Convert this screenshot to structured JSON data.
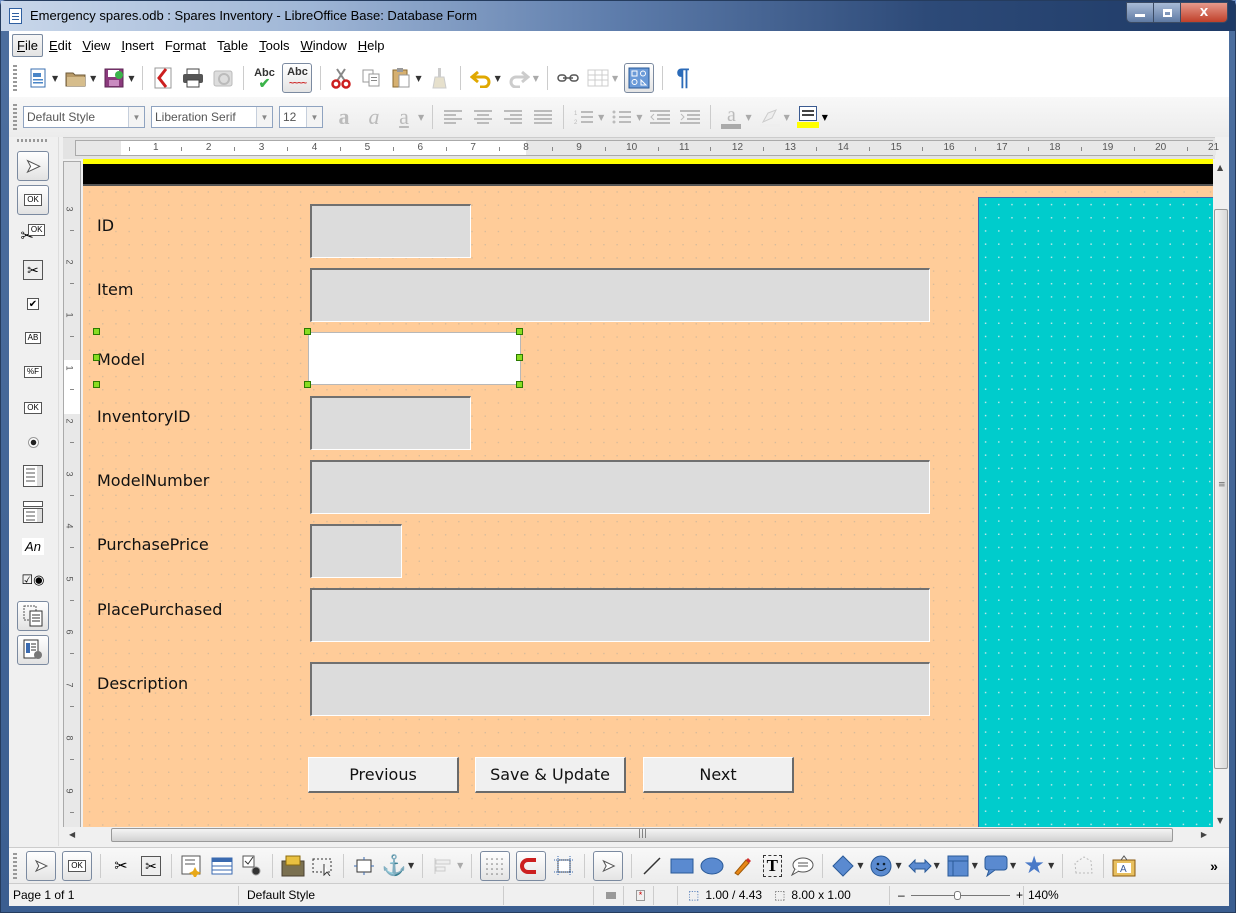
{
  "window": {
    "title": "Emergency spares.odb : Spares Inventory - LibreOffice Base: Database Form",
    "controls": {
      "minimize": "–",
      "maximize": "□",
      "close": "X"
    }
  },
  "menubar": {
    "items": [
      {
        "label": "File",
        "accel": "F",
        "rest": "ile"
      },
      {
        "label": "Edit",
        "accel": "E",
        "rest": "dit"
      },
      {
        "label": "View",
        "accel": "V",
        "rest": "iew"
      },
      {
        "label": "Insert",
        "accel": "I",
        "rest": "nsert"
      },
      {
        "label": "Format",
        "pre": "F",
        "accel": "o",
        "rest": "rmat"
      },
      {
        "label": "Table",
        "pre": "T",
        "accel": "a",
        "rest": "ble"
      },
      {
        "label": "Tools",
        "accel": "T",
        "rest": "ools"
      },
      {
        "label": "Window",
        "accel": "W",
        "rest": "indow"
      },
      {
        "label": "Help",
        "accel": "H",
        "rest": "elp"
      }
    ]
  },
  "standard_toolbar": {
    "icons": [
      "new-document-icon",
      "open-folder-icon",
      "save-icon",
      "export-pdf-icon",
      "print-icon",
      "print-preview-icon",
      "spellcheck-icon",
      "autospellcheck-icon",
      "cut-icon",
      "copy-icon",
      "paste-icon",
      "clone-formatting-icon",
      "undo-icon",
      "redo-icon",
      "hyperlink-icon",
      "table-icon",
      "draw-functions-icon",
      "formatting-marks-icon"
    ],
    "spell_label": "Abc"
  },
  "formatting_toolbar": {
    "paragraph_style": "Default Style",
    "font_name": "Liberation Serif",
    "font_size": "12",
    "highlight_color": "#ffff00"
  },
  "ruler": {
    "h_numbers": [
      "1",
      "2",
      "3",
      "4",
      "5",
      "6",
      "7",
      "8",
      "9",
      "10",
      "11",
      "12",
      "13",
      "14",
      "15",
      "16",
      "17",
      "18",
      "19",
      "20",
      "21"
    ],
    "v_numbers": [
      "3",
      "2",
      "1",
      "1",
      "2",
      "3",
      "4",
      "5",
      "6",
      "7",
      "8",
      "9"
    ]
  },
  "form_controls_toolbar": {
    "items": [
      "select-icon",
      "design-mode-icon",
      "control-properties-icon",
      "form-properties-icon",
      "checkbox-icon",
      "text-box-icon",
      "formatted-field-icon",
      "push-button-icon",
      "option-button-icon",
      "list-box-icon",
      "combo-box-icon",
      "label-field-icon",
      "more-controls-icon",
      "form-design-icon",
      "wizards-icon"
    ],
    "label_an": "An",
    "label_ok": "OK",
    "label_abi": "AB",
    "label_pct": "%F"
  },
  "form": {
    "background_color": "#ffcc99",
    "side_panel_color": "#00cccc",
    "fields": [
      {
        "label": "ID",
        "value": ""
      },
      {
        "label": "Item",
        "value": ""
      },
      {
        "label": "Model",
        "value": "",
        "selected": true
      },
      {
        "label": "InventoryID",
        "value": ""
      },
      {
        "label": "ModelNumber",
        "value": ""
      },
      {
        "label": "PurchasePrice",
        "value": ""
      },
      {
        "label": "PlacePurchased",
        "value": ""
      },
      {
        "label": "Description",
        "value": ""
      }
    ],
    "buttons": {
      "previous": "Previous",
      "save_update": "Save & Update",
      "next": "Next"
    }
  },
  "drawing_toolbar": {
    "icons": [
      "select-icon",
      "design-mode-icon",
      "control-properties-icon",
      "form-properties-icon",
      "add-field-icon",
      "form-navigator-icon",
      "activation-order-icon",
      "open-design-mode-icon",
      "automatic-control-focus-icon",
      "position-size-icon",
      "anchor-icon",
      "align-icon",
      "grid-icon",
      "snap-to-grid-icon",
      "guides-icon",
      "select-icon",
      "line-icon",
      "rectangle-icon",
      "ellipse-icon",
      "freeform-icon",
      "text-icon",
      "callout-icon",
      "basic-shapes-icon",
      "symbol-shapes-icon",
      "block-arrows-icon",
      "flowchart-icon",
      "callouts-icon",
      "stars-icon",
      "points-icon",
      "fontwork-icon",
      "more-icon"
    ]
  },
  "statusbar": {
    "page": "Page 1 of 1",
    "style": "Default Style",
    "position": "1.00 / 4.43",
    "size": "8.00 x 1.00",
    "zoom": "140%",
    "zoom_fraction": 0.46
  }
}
